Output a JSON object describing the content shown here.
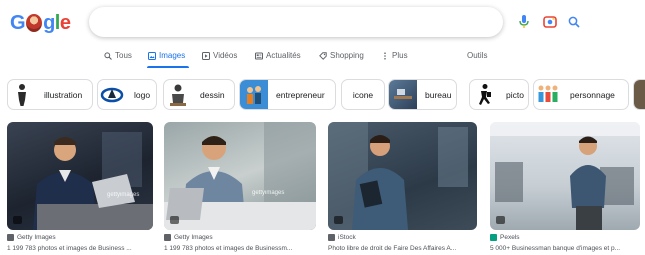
{
  "logo": {
    "text_parts": [
      "G",
      "gle"
    ]
  },
  "search": {
    "value": "",
    "placeholder": ""
  },
  "tabs": [
    {
      "label": "Tous",
      "icon": "search-icon"
    },
    {
      "label": "Images",
      "icon": "image-icon",
      "active": true
    },
    {
      "label": "Vidéos",
      "icon": "video-icon"
    },
    {
      "label": "Actualités",
      "icon": "news-icon"
    },
    {
      "label": "Shopping",
      "icon": "tag-icon"
    },
    {
      "label": "Plus",
      "icon": "more-vert-icon"
    },
    {
      "label": "Outils"
    }
  ],
  "chips": [
    {
      "label": "illustration"
    },
    {
      "label": "logo"
    },
    {
      "label": "dessin"
    },
    {
      "label": "entrepreneur"
    },
    {
      "label": "icone"
    },
    {
      "label": "bureau"
    },
    {
      "label": "picto"
    },
    {
      "label": "personnage"
    }
  ],
  "results": [
    {
      "source": "Getty Images",
      "title": "1 199 783 photos et images de Business ...",
      "fav_color": "#5f6368"
    },
    {
      "source": "Getty Images",
      "title": "1 199 783 photos et images de Businessm...",
      "fav_color": "#5f6368"
    },
    {
      "source": "iStock",
      "title": "Photo libre de droit de Faire Des Affaires A...",
      "fav_color": "#5f6368"
    },
    {
      "source": "Pexels",
      "title": "5 000+ Businessman banque d'images et p...",
      "fav_color": "#05a081"
    }
  ],
  "colors": {
    "accent": "#1a73e8",
    "mic_blue": "#4285f4",
    "lens_red": "#ea4335"
  }
}
